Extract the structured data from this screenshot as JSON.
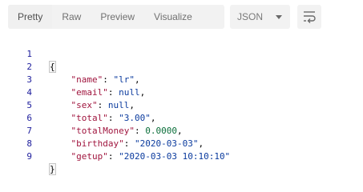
{
  "toolbar": {
    "tabs": [
      {
        "label": "Pretty",
        "active": true
      },
      {
        "label": "Raw",
        "active": false
      },
      {
        "label": "Preview",
        "active": false
      },
      {
        "label": "Visualize",
        "active": false
      }
    ],
    "format": {
      "selected": "JSON",
      "icon": "chevron-down-icon"
    },
    "wrap_icon": "wrap-lines-icon"
  },
  "json_body": {
    "lines": [
      {
        "num": "1",
        "open": "{"
      },
      {
        "num": "2",
        "key": "\"name\"",
        "value": "\"lr\"",
        "vtype": "str",
        "comma": ","
      },
      {
        "num": "3",
        "key": "\"email\"",
        "value": "null",
        "vtype": "kw",
        "comma": ","
      },
      {
        "num": "4",
        "key": "\"sex\"",
        "value": "null",
        "vtype": "kw",
        "comma": ","
      },
      {
        "num": "5",
        "key": "\"total\"",
        "value": "\"3.00\"",
        "vtype": "str",
        "comma": ","
      },
      {
        "num": "6",
        "key": "\"totalMoney\"",
        "value": "0.0000",
        "vtype": "num",
        "comma": ","
      },
      {
        "num": "7",
        "key": "\"birthday\"",
        "value": "\"2020-03-03\"",
        "vtype": "str",
        "comma": ","
      },
      {
        "num": "8",
        "key": "\"getup\"",
        "value": "\"2020-03-03 10:10:10\"",
        "vtype": "str",
        "comma": ""
      },
      {
        "num": "9",
        "close": "}"
      }
    ]
  }
}
